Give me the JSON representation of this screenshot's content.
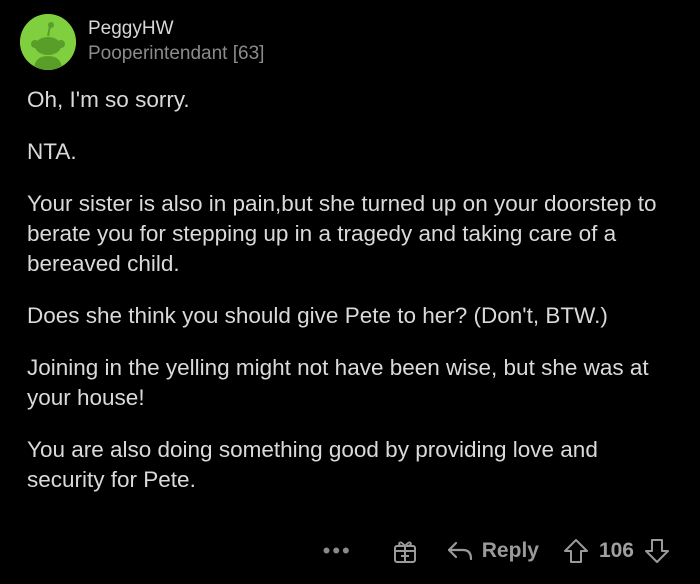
{
  "comment": {
    "author": "PeggyHW",
    "flair": "Pooperintendant [63]",
    "paragraphs": [
      "Oh, I'm so sorry.",
      "NTA.",
      "Your sister is also in pain,but she turned up on your doorstep to berate you for stepping up in a tragedy and taking care of a bereaved child.",
      "Does she think you should give Pete to her? (Don't, BTW.)",
      "Joining in the yelling might not have been wise, but she was at your house!",
      "You are also doing something good by providing love and security for Pete."
    ]
  },
  "actions": {
    "more_label": "•••",
    "reply_label": "Reply",
    "vote_count": "106"
  },
  "colors": {
    "background": "#000000",
    "avatar": "#7fcf3f",
    "text": "#dadada",
    "muted": "#8b8b8b"
  },
  "icons": [
    "snoo-avatar-icon",
    "award-icon",
    "reply-arrow-icon",
    "upvote-icon",
    "downvote-icon"
  ]
}
